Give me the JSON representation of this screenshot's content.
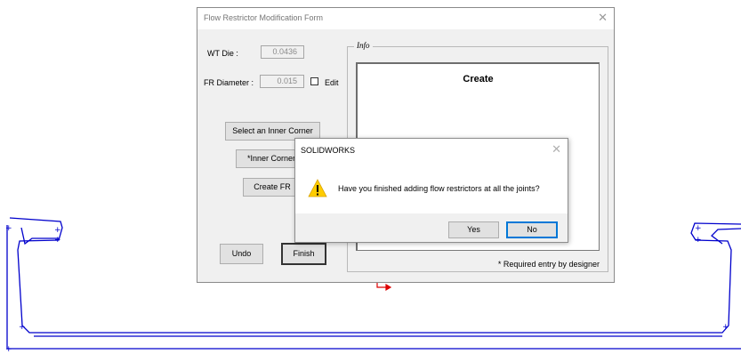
{
  "form": {
    "title": "Flow Restrictor Modification Form",
    "close_glyph": "✕",
    "wt_die_label": "WT Die :",
    "wt_die_value": "0.0436",
    "fr_diameter_label": "FR Diameter :",
    "fr_diameter_value": "0.015",
    "edit_label": "Edit",
    "edit_checked": false,
    "buttons": {
      "select_inner_corner": "Select an Inner Corner",
      "inner_corner": "*Inner Corner",
      "create_fr": "Create FR",
      "undo": "Undo",
      "finish": "Finish"
    },
    "info_group_title": "Info",
    "info_text": "Create",
    "required_note": "* Required entry by designer"
  },
  "message_box": {
    "title": "SOLIDWORKS",
    "close_glyph": "✕",
    "icon": "warning-icon",
    "text": "Have you finished adding flow restrictors at all the joints?",
    "yes_label": "Yes",
    "no_label": "No"
  },
  "colors": {
    "sketch_line": "#0000cc",
    "origin_marker": "#dd0000",
    "warning_yellow": "#ffcc00",
    "focus_blue": "#0078d7"
  }
}
